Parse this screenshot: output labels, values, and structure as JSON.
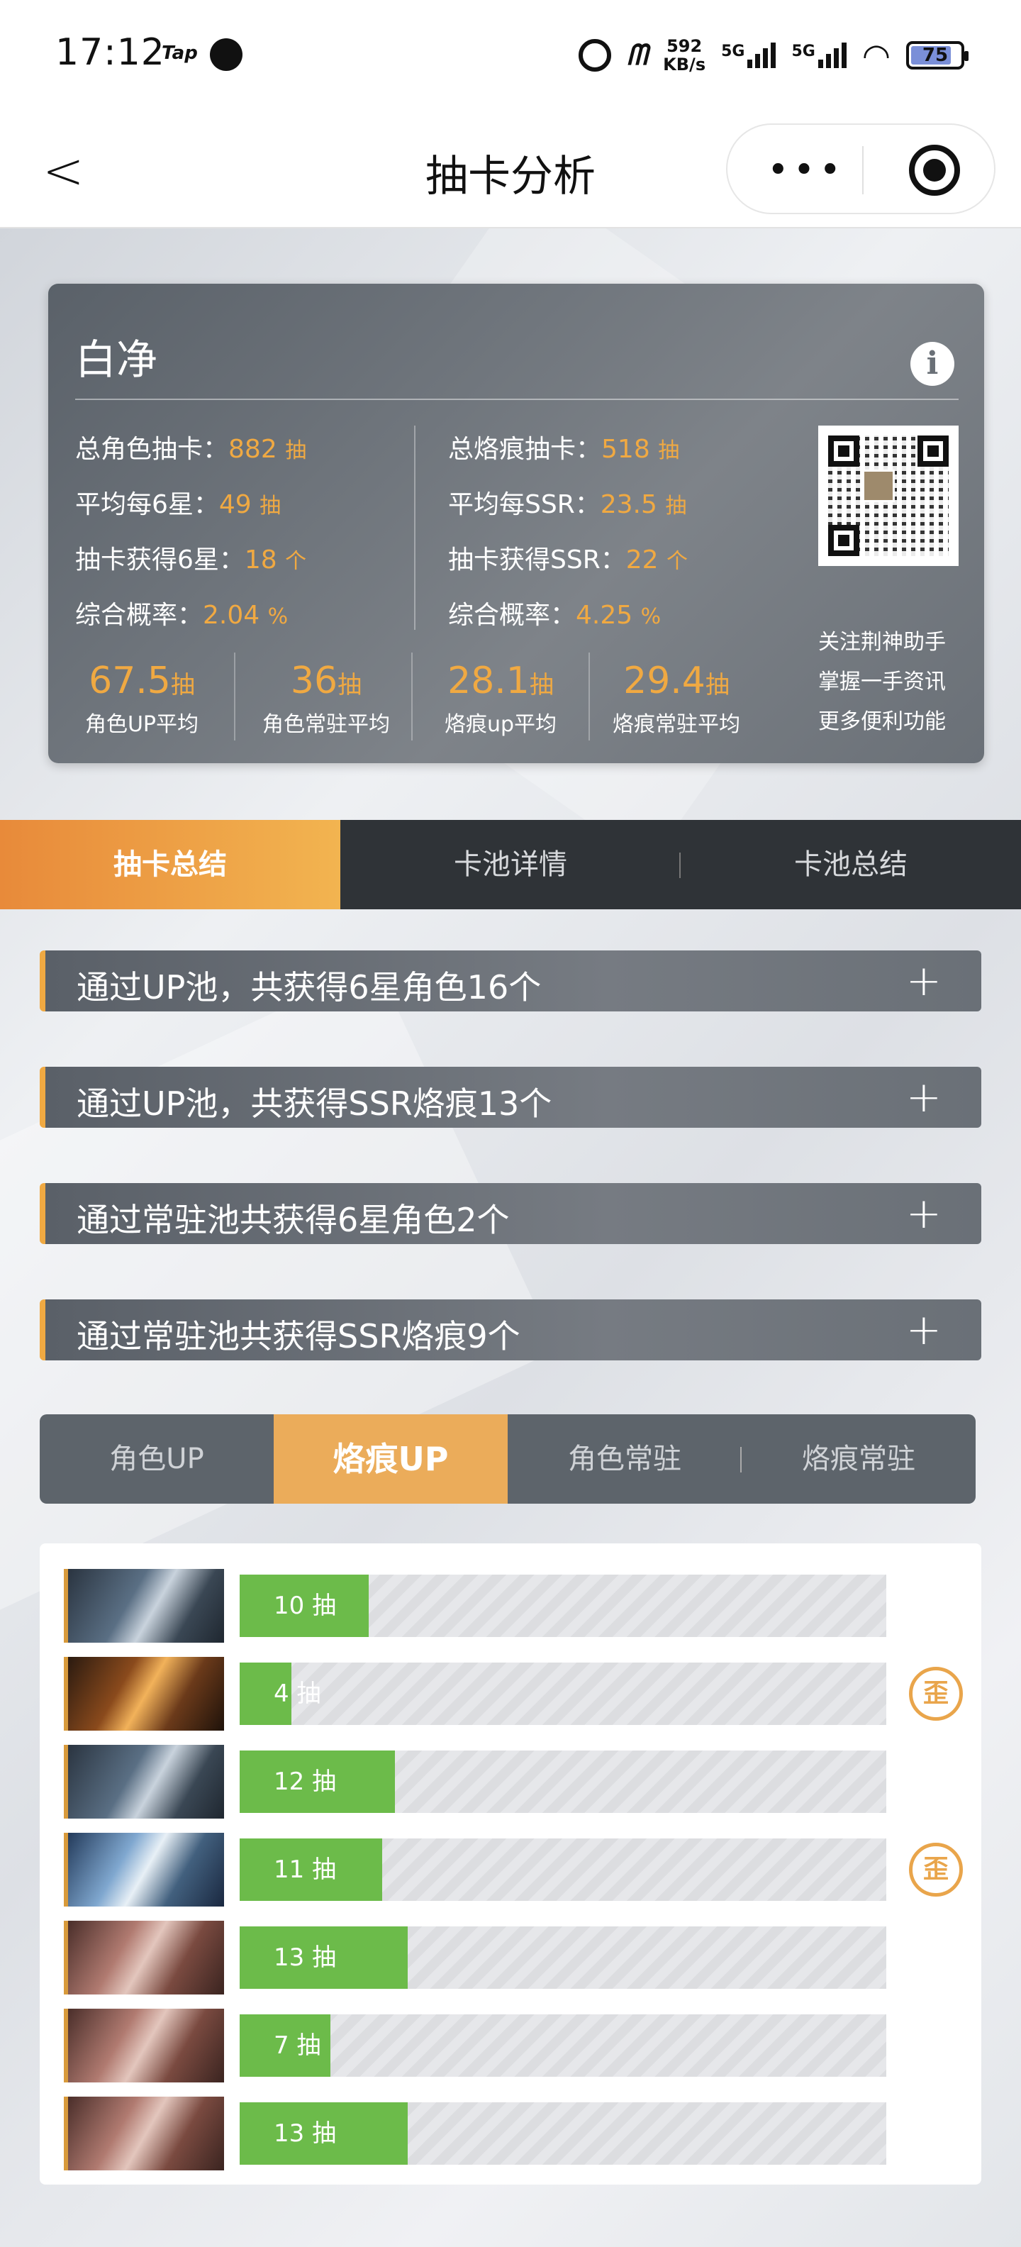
{
  "status_bar": {
    "time": "17:12",
    "app_tag": "Tap",
    "net_speed_value": "592",
    "net_speed_unit": "KB/s",
    "sig1_label": "5G",
    "sig2_label": "5G",
    "battery": "75"
  },
  "nav": {
    "back_glyph": "<",
    "title": "抽卡分析",
    "more_glyph": "•••"
  },
  "profile": {
    "name": "白净",
    "info_glyph": "i",
    "left_stats": [
      {
        "label": "总角色抽卡：",
        "value": "882",
        "unit": "抽"
      },
      {
        "label": "平均每6星：",
        "value": "49",
        "unit": "抽"
      },
      {
        "label": "抽卡获得6星：",
        "value": "18",
        "unit": "个"
      },
      {
        "label": "综合概率：",
        "value": "2.04",
        "unit": "%"
      }
    ],
    "right_stats": [
      {
        "label": "总烙痕抽卡：",
        "value": "518",
        "unit": "抽"
      },
      {
        "label": "平均每SSR：",
        "value": "23.5",
        "unit": "抽"
      },
      {
        "label": "抽卡获得SSR：",
        "value": "22",
        "unit": "个"
      },
      {
        "label": "综合概率：",
        "value": "4.25",
        "unit": "%"
      }
    ],
    "averages": [
      {
        "value": "67.5",
        "unit": "抽",
        "label": "角色UP平均"
      },
      {
        "value": "36",
        "unit": "抽",
        "label": "角色常驻平均"
      },
      {
        "value": "28.1",
        "unit": "抽",
        "label": "烙痕up平均"
      },
      {
        "value": "29.4",
        "unit": "抽",
        "label": "烙痕常驻平均"
      }
    ],
    "promo_lines": [
      "关注荆神助手",
      "掌握一手资讯",
      "更多便利功能"
    ]
  },
  "main_tabs": [
    "抽卡总结",
    "卡池详情",
    "卡池总结"
  ],
  "summaries": [
    "通过UP池，共获得6星角色16个",
    "通过UP池，共获得SSR烙痕13个",
    "通过常驻池共获得6星角色2个",
    "通过常驻池共获得SSR烙痕9个"
  ],
  "expand_glyph": "+",
  "pool_tabs": [
    "角色UP",
    "烙痕UP",
    "角色常驻",
    "烙痕常驻"
  ],
  "pull_list": [
    {
      "count": "10",
      "unit": "抽",
      "progress": 0.2,
      "wai": false,
      "thumb": "t1"
    },
    {
      "count": "4",
      "unit": "抽",
      "progress": 0.08,
      "wai": true,
      "thumb": "t2"
    },
    {
      "count": "12",
      "unit": "抽",
      "progress": 0.24,
      "wai": false,
      "thumb": "t1"
    },
    {
      "count": "11",
      "unit": "抽",
      "progress": 0.22,
      "wai": true,
      "thumb": "t3"
    },
    {
      "count": "13",
      "unit": "抽",
      "progress": 0.26,
      "wai": false,
      "thumb": "t4"
    },
    {
      "count": "7",
      "unit": "抽",
      "progress": 0.14,
      "wai": false,
      "thumb": "t4"
    },
    {
      "count": "13",
      "unit": "抽",
      "progress": 0.26,
      "wai": false,
      "thumb": "t4"
    }
  ],
  "wai_badge_text": "歪",
  "colors": {
    "accent_orange": "#f0a942",
    "progress_green": "#6cbb4a",
    "card_gray": "#6a7077"
  }
}
